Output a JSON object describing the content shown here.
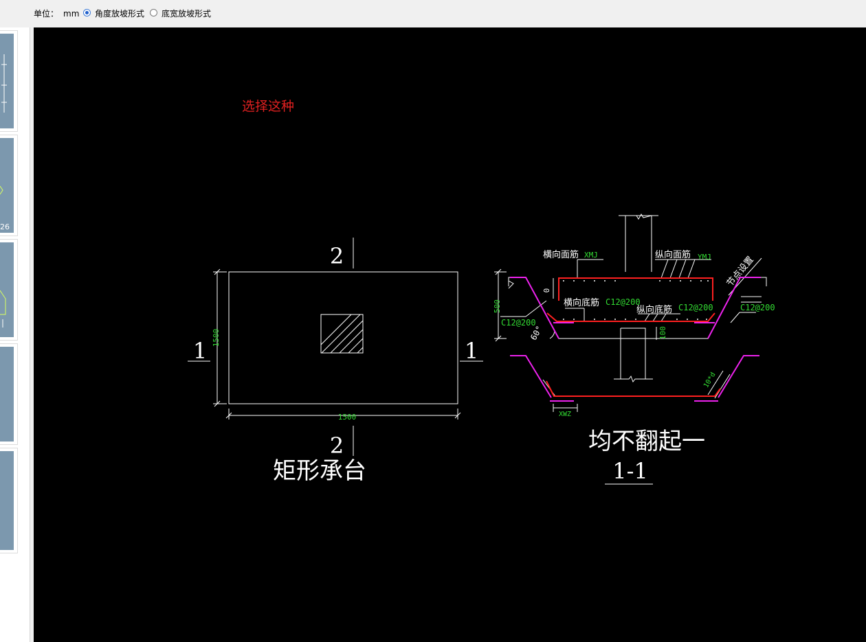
{
  "toolbar": {
    "unit_label": "单位：",
    "unit_value": "mm",
    "option_angle": "角度放坡形式",
    "option_width": "底宽放坡形式",
    "selected_option": "角度放坡形式"
  },
  "thumbnails": [
    {
      "name": "thumbnail-1",
      "caption": ""
    },
    {
      "name": "thumbnail-2",
      "caption": "26"
    },
    {
      "name": "thumbnail-3",
      "caption": ""
    },
    {
      "name": "thumbnail-4",
      "caption": ""
    },
    {
      "name": "thumbnail-5",
      "caption": ""
    }
  ],
  "drawing": {
    "annotation": "选择这种",
    "plan": {
      "title": "矩形承台",
      "section_mark_2_top": "2",
      "section_mark_2_bottom": "2",
      "section_mark_1_left": "1",
      "section_mark_1_right": "1",
      "dim_height": "1500",
      "dim_width": "1500"
    },
    "section": {
      "title": "均不翻起一",
      "section_label": "1-1",
      "label_transverse_top": "横向面筋",
      "code_transverse_top": "XMJ",
      "label_longitudinal_top": "纵向面筋",
      "code_longitudinal_top": "YMJ",
      "label_transverse_bottom": "横向底筋",
      "spec_transverse_bottom": "C12@200",
      "label_longitudinal_bottom": "纵向底筋",
      "spec_longitudinal_bottom": "C12@200",
      "spec_right_side": "C12@200",
      "spec_left_side": "C12@200",
      "node_setting": "节点设置",
      "dim_depth": "500",
      "dim_zero": "0",
      "dim_100": "100",
      "angle": "60°",
      "label_10d": "10*d",
      "label_xwz": "XWZ"
    }
  },
  "colors": {
    "canvas_bg": "#000000",
    "line_white": "#ffffff",
    "text_green": "#33dd33",
    "rebar_red": "#ff2020",
    "rebar_magenta": "#ee22ee",
    "annotation_red": "#e02020",
    "thumb_bg": "#7c98ae"
  }
}
